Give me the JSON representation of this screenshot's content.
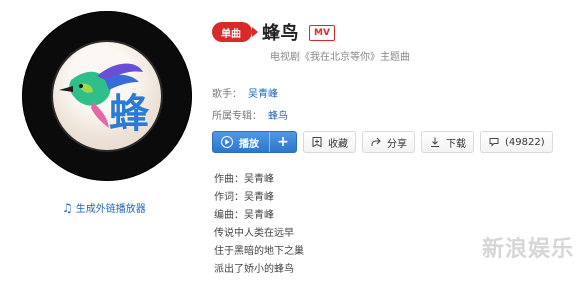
{
  "song": {
    "badge": "单曲",
    "title": "蜂鸟",
    "mv_badge": "MV",
    "subtitle": "电视剧《我在北京等你》主题曲"
  },
  "meta": {
    "artist_label": "歌手：",
    "artist_name": "吴青峰",
    "album_label": "所属专辑：",
    "album_name": "蜂鸟"
  },
  "actions": {
    "play_label": "播放",
    "plus_label": "+",
    "collect_label": "收藏",
    "share_label": "分享",
    "download_label": "下载",
    "comments_label": "(49822)"
  },
  "left": {
    "player_link_label": "生成外链播放器",
    "cover_text": "蜂"
  },
  "lyrics": {
    "lines": [
      "作曲：吴青峰",
      "作词：吴青峰",
      "编曲：吴青峰",
      "传说中人类在远早",
      "住于黑暗的地下之巢",
      "派出了娇小的蜂鸟"
    ]
  },
  "watermark": {
    "text": "新浪娱乐"
  },
  "colors": {
    "accent_blue": "#2f76cc",
    "link_blue": "#1f64b8",
    "badge_red": "#d82a2a"
  },
  "icons": {
    "collect": "bookmark-plus-icon",
    "share": "share-icon",
    "download": "download-icon",
    "comments": "comment-icon",
    "player": "music-note-icon",
    "play": "play-circle-icon"
  }
}
